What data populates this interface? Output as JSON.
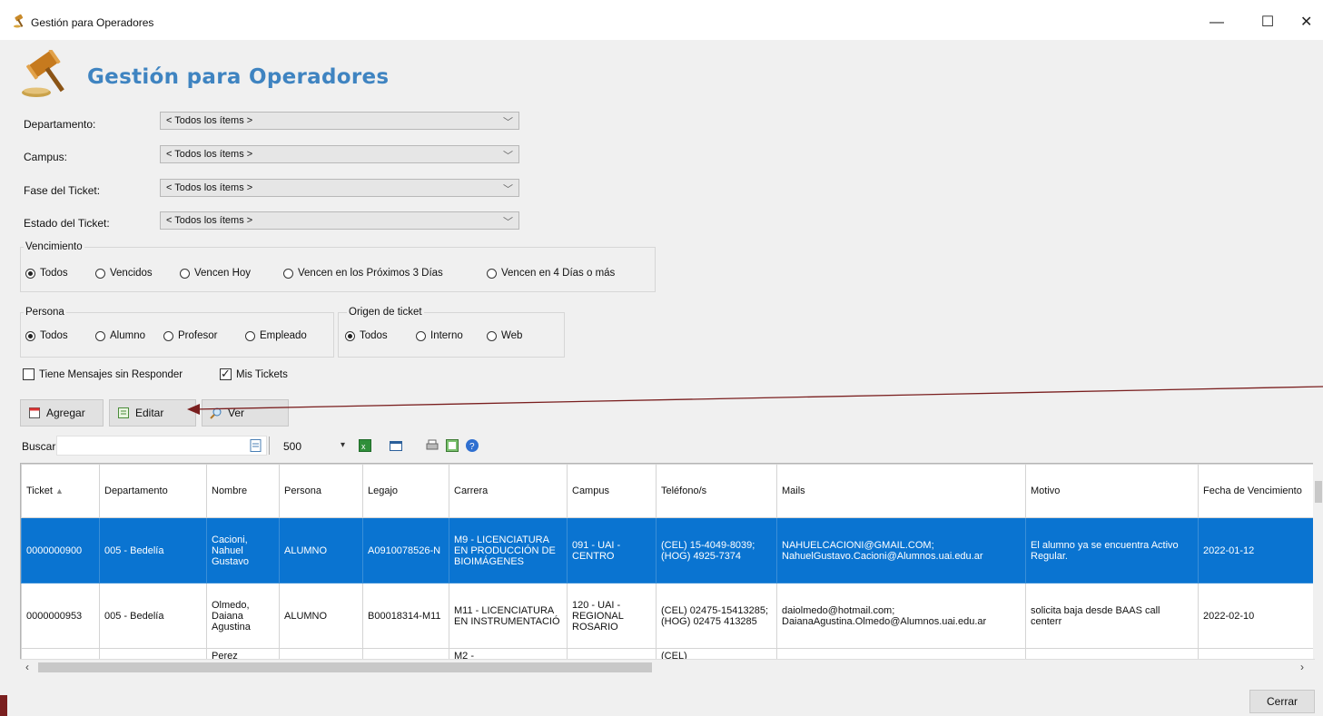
{
  "window": {
    "title": "Gestión para Operadores",
    "controls": [
      "—",
      "☐",
      "✕"
    ]
  },
  "header": {
    "title": "Gestión para Operadores"
  },
  "filters": {
    "departamento": {
      "label": "Departamento:",
      "value": "< Todos los ítems >"
    },
    "campus": {
      "label": "Campus:",
      "value": "< Todos los ítems >"
    },
    "fase": {
      "label": "Fase del Ticket:",
      "value": "< Todos los ítems >"
    },
    "estado": {
      "label": "Estado del Ticket:",
      "value": "< Todos los ítems >"
    }
  },
  "vencimiento": {
    "title": "Vencimiento",
    "options": [
      "Todos",
      "Vencidos",
      "Vencen Hoy",
      "Vencen en los Próximos 3 Días",
      "Vencen en 4 Días o más"
    ],
    "selected": "Todos"
  },
  "persona": {
    "title": "Persona",
    "options": [
      "Todos",
      "Alumno",
      "Profesor",
      "Empleado"
    ],
    "selected": "Todos"
  },
  "origen": {
    "title": "Origen de ticket",
    "options": [
      "Todos",
      "Interno",
      "Web"
    ],
    "selected": "Todos"
  },
  "checks": {
    "sin_responder": {
      "label": "Tiene Mensajes sin Responder",
      "checked": false
    },
    "mis_tickets": {
      "label": "Mis Tickets",
      "checked": true
    }
  },
  "buttons": {
    "agregar": "Agregar",
    "editar": "Editar",
    "ver": "Ver",
    "cerrar": "Cerrar"
  },
  "search": {
    "label": "Buscar:",
    "page_size": "500"
  },
  "grid": {
    "headers": [
      "Ticket",
      "Departamento",
      "Nombre",
      "Persona",
      "Legajo",
      "Carrera",
      "Campus",
      "Teléfono/s",
      "Mails",
      "Motivo",
      "Fecha de Vencimiento"
    ],
    "rows": [
      [
        "0000000900",
        "005 - Bedelía",
        "Cacioni, Nahuel Gustavo",
        "ALUMNO",
        "A0910078526-N",
        "M9 - LICENCIATURA EN PRODUCCIÓN DE BIOIMÁGENES",
        "091 - UAI - CENTRO",
        "(CEL) 15-4049-8039; (HOG) 4925-7374",
        "NAHUELCACIONI@GMAIL.COM; NahuelGustavo.Cacioni@Alumnos.uai.edu.ar",
        "El alumno ya se encuentra Activo Regular.",
        "2022-01-12"
      ],
      [
        "0000000953",
        "005 - Bedelía",
        "Olmedo, Daiana Agustina",
        "ALUMNO",
        "B00018314-M11",
        "M11 - LICENCIATURA EN INSTRUMENTACIÓ",
        "120 - UAI - REGIONAL ROSARIO",
        "(CEL) 02475-15413285; (HOG) 02475 413285",
        "daiolmedo@hotmail.com; DaianaAgustina.Olmedo@Alumnos.uai.edu.ar",
        "solicita baja desde BAAS call centerr",
        "2022-02-10"
      ],
      [
        "",
        "",
        "Perez",
        "",
        "",
        "M2 -",
        "",
        "(CEL)",
        "",
        "",
        ""
      ]
    ]
  },
  "colors": {
    "accent": "#3f84c1",
    "selection": "#0a74d1",
    "arrow": "#7a1f1f"
  },
  "icons": [
    "gavel-icon",
    "new-icon",
    "edit-icon",
    "search-icon",
    "refresh-icon",
    "excel-icon",
    "layout-icon",
    "print-icon",
    "export-icon",
    "help-icon"
  ]
}
